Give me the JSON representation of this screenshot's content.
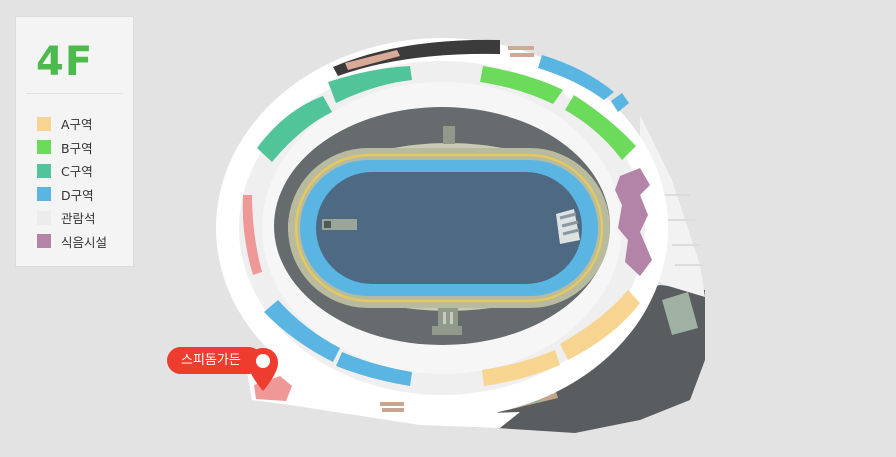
{
  "floor": "4F",
  "legend": {
    "items": [
      {
        "label": "A구역",
        "color": "#f7d490"
      },
      {
        "label": "B구역",
        "color": "#6cda5a"
      },
      {
        "label": "C구역",
        "color": "#52c49a"
      },
      {
        "label": "D구역",
        "color": "#5ab5e3"
      },
      {
        "label": "관람석",
        "color": "#ececec"
      },
      {
        "label": "식음시설",
        "color": "#b383a8"
      }
    ]
  },
  "marker": {
    "label": "스피돔가든",
    "color": "#ee3d2f"
  }
}
